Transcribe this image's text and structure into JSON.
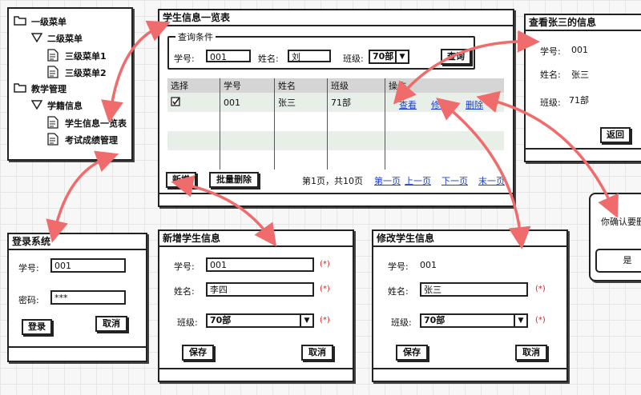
{
  "menu_tree": {
    "items": [
      {
        "label": "一级菜单",
        "icon": "folder-icon"
      },
      {
        "label": "二级菜单",
        "icon": "triangle-down-icon"
      },
      {
        "label": "三级菜单1",
        "icon": "document-icon"
      },
      {
        "label": "三级菜单2",
        "icon": "document-icon"
      },
      {
        "label": "教学管理",
        "icon": "folder-icon"
      },
      {
        "label": "学籍信息",
        "icon": "triangle-down-icon"
      },
      {
        "label": "学生信息一览表",
        "icon": "document-icon"
      },
      {
        "label": "考试成绩管理",
        "icon": "document-icon"
      }
    ]
  },
  "student_list": {
    "title": "学生信息一览表",
    "query_legend": "查询条件",
    "id_label": "学号:",
    "id_value": "001",
    "name_label": "姓名:",
    "name_value": "刘",
    "class_label": "班级:",
    "class_value": "70部",
    "query_button": "查询",
    "columns": [
      "选择",
      "学号",
      "姓名",
      "班级",
      "操作"
    ],
    "row": {
      "id": "001",
      "name": "张三",
      "class": "71部"
    },
    "actions": [
      "查看",
      "修改",
      "删除"
    ],
    "add_button": "新增",
    "batch_delete_button": "批量删除",
    "page_info": "第1页，共10页",
    "pager": [
      "第一页",
      "上一页",
      "下一页",
      "末一页"
    ]
  },
  "view_detail": {
    "title": "查看张三的信息",
    "id_label": "学号:",
    "id_value": "001",
    "name_label": "姓名:",
    "name_value": "张三",
    "class_label": "班级:",
    "class_value": "71部",
    "back_button": "返回"
  },
  "confirm_dialog": {
    "message": "你确认要删",
    "yes_button": "是"
  },
  "login": {
    "title": "登录系统",
    "user_label": "学号:",
    "user_value": "001",
    "password_label": "密码:",
    "password_value": "***",
    "login_button": "登录",
    "cancel_button": "取消"
  },
  "add_student": {
    "title": "新增学生信息",
    "id_label": "学号:",
    "id_value": "001",
    "name_label": "姓名:",
    "name_value": "李四",
    "class_label": "班级:",
    "class_value": "70部",
    "required_mark": "(*)",
    "save_button": "保存",
    "cancel_button": "取消"
  },
  "edit_student": {
    "title": "修改学生信息",
    "id_label": "学号:",
    "id_value": "001",
    "name_label": "姓名:",
    "name_value": "张三",
    "class_label": "班级:",
    "class_value": "70部",
    "required_mark": "(*)",
    "save_button": "保存",
    "cancel_button": "取消"
  },
  "colors": {
    "arrow": "#f06b6b",
    "link": "#1a3fd0",
    "required": "#dd2222",
    "header_row": "#d5d5d5",
    "alt_row": "#e8efe8"
  }
}
